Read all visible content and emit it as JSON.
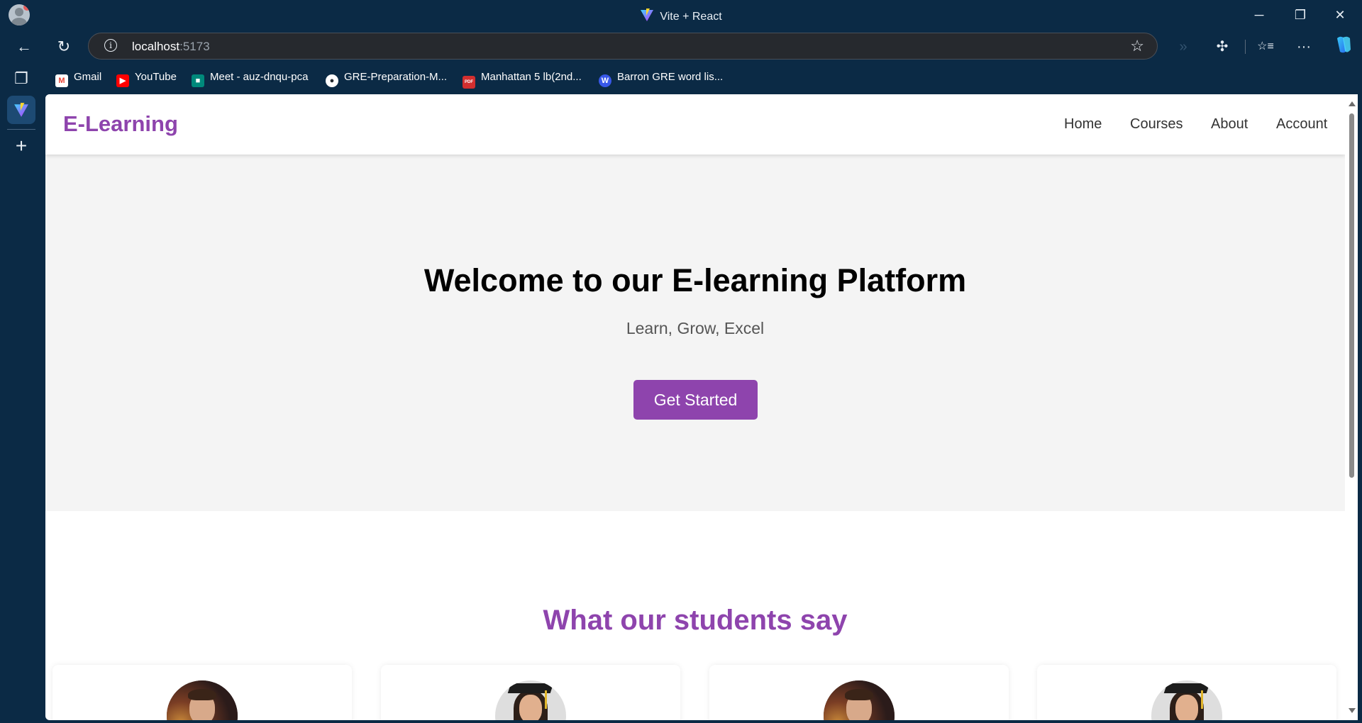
{
  "browser": {
    "tab_title": "Vite + React",
    "address": {
      "host": "localhost",
      "port": ":5173"
    },
    "window_controls": {
      "minimize": "─",
      "restore": "❐",
      "close": "✕"
    },
    "icons": {
      "back": "←",
      "reload": "↻",
      "info": "i",
      "favorite": "☆",
      "extensions_forward": "»",
      "extensions": "✣",
      "favorites": "☆≡",
      "more": "···"
    },
    "bookmarks": [
      {
        "label": "Gmail",
        "icon": "gmail-icon",
        "color": "#ea4335",
        "glyph": "M"
      },
      {
        "label": "YouTube",
        "icon": "youtube-icon",
        "color": "#ff0000",
        "glyph": "▶"
      },
      {
        "label": "Meet - auz-dnqu-pca",
        "icon": "meet-icon",
        "color": "#00897b",
        "glyph": "■"
      },
      {
        "label": "GRE-Preparation-M...",
        "icon": "github-icon",
        "color": "#24292e",
        "glyph": "●"
      },
      {
        "label": "Manhattan 5 lb(2nd...",
        "icon": "pdf-icon",
        "color": "#d32f2f",
        "glyph": "PDF"
      },
      {
        "label": "Barron GRE word lis...",
        "icon": "wordpress-icon",
        "color": "#3858e9",
        "glyph": "W"
      }
    ],
    "sidebar": {
      "tabs_icon": "❐",
      "add_icon": "+"
    }
  },
  "site": {
    "logo": "E-Learning",
    "nav": [
      "Home",
      "Courses",
      "About",
      "Account"
    ],
    "hero": {
      "title": "Welcome to our E-learning Platform",
      "subtitle": "Learn, Grow, Excel",
      "cta": "Get Started"
    },
    "testimonials": {
      "heading": "What our students say",
      "avatars": [
        "male-graduate",
        "female-graduate",
        "male-graduate",
        "female-graduate"
      ]
    },
    "colors": {
      "brand": "#8e44ad",
      "hero_bg": "#f4f4f4",
      "browser_chrome": "#0b2a45"
    }
  }
}
